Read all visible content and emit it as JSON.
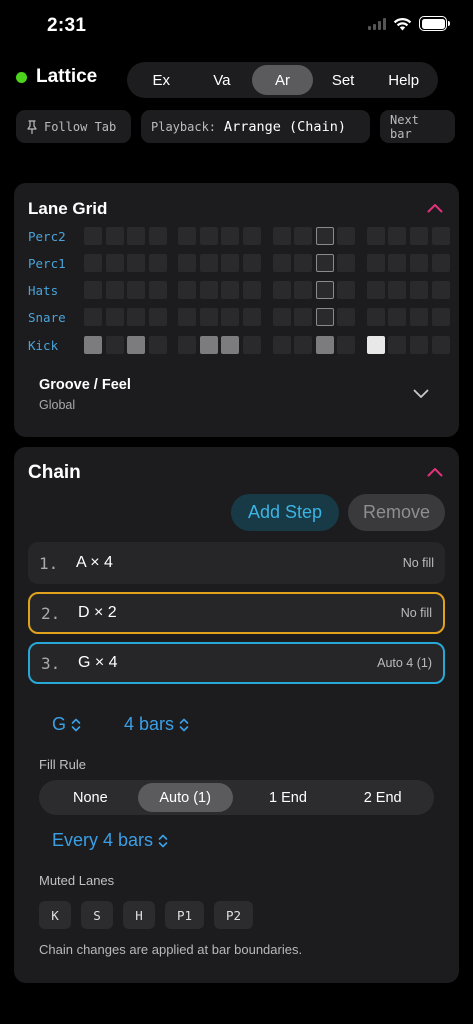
{
  "status": {
    "time": "2:31"
  },
  "app": {
    "name": "Lattice"
  },
  "top_tabs": [
    {
      "label": "Ex",
      "active": false
    },
    {
      "label": "Va",
      "active": false
    },
    {
      "label": "Ar",
      "active": true
    },
    {
      "label": "Set",
      "active": false
    },
    {
      "label": "Help",
      "active": false
    }
  ],
  "toolbar": {
    "follow_tab": "Follow Tab",
    "playback_label": "Playback:",
    "playback_value": "Arrange (Chain)",
    "next_bar": "Next bar"
  },
  "lane_grid": {
    "title": "Lane Grid",
    "lanes": [
      {
        "name": "Perc2",
        "on": [],
        "bright": []
      },
      {
        "name": "Perc1",
        "on": [],
        "bright": []
      },
      {
        "name": "Hats",
        "on": [],
        "bright": []
      },
      {
        "name": "Snare",
        "on": [],
        "bright": []
      },
      {
        "name": "Kick",
        "on": [
          0,
          2,
          5,
          6,
          10
        ],
        "bright": [
          12
        ]
      }
    ],
    "steps": 16,
    "playhead_step": 10,
    "groove_title": "Groove / Feel",
    "groove_sub": "Global"
  },
  "chain": {
    "title": "Chain",
    "add_step": "Add Step",
    "remove": "Remove",
    "steps": [
      {
        "num": "1.",
        "label": "A × 4",
        "fill": "No fill",
        "state": "normal"
      },
      {
        "num": "2.",
        "label": "D × 2",
        "fill": "No fill",
        "state": "orange"
      },
      {
        "num": "3.",
        "label": "G × 4",
        "fill": "Auto 4 (1)",
        "state": "blue"
      }
    ],
    "pattern_picker": "G",
    "bars_picker": "4 bars",
    "fill_rule_label": "Fill Rule",
    "fill_rule_options": [
      {
        "label": "None",
        "active": false
      },
      {
        "label": "Auto (1)",
        "active": true
      },
      {
        "label": "1 End",
        "active": false
      },
      {
        "label": "2 End",
        "active": false
      }
    ],
    "every_picker": "Every 4 bars",
    "muted_lanes_label": "Muted Lanes",
    "muted_lanes": [
      "K",
      "S",
      "H",
      "P1",
      "P2"
    ],
    "note": "Chain changes are applied at bar boundaries."
  },
  "colors": {
    "accent_blue": "#3b9fe6",
    "lane_blue": "#4aa3d8",
    "active_green": "#4cd41d",
    "collapse_pink": "#e0337a",
    "orange_border": "#e0a21d",
    "blue_border": "#27a8d6"
  }
}
